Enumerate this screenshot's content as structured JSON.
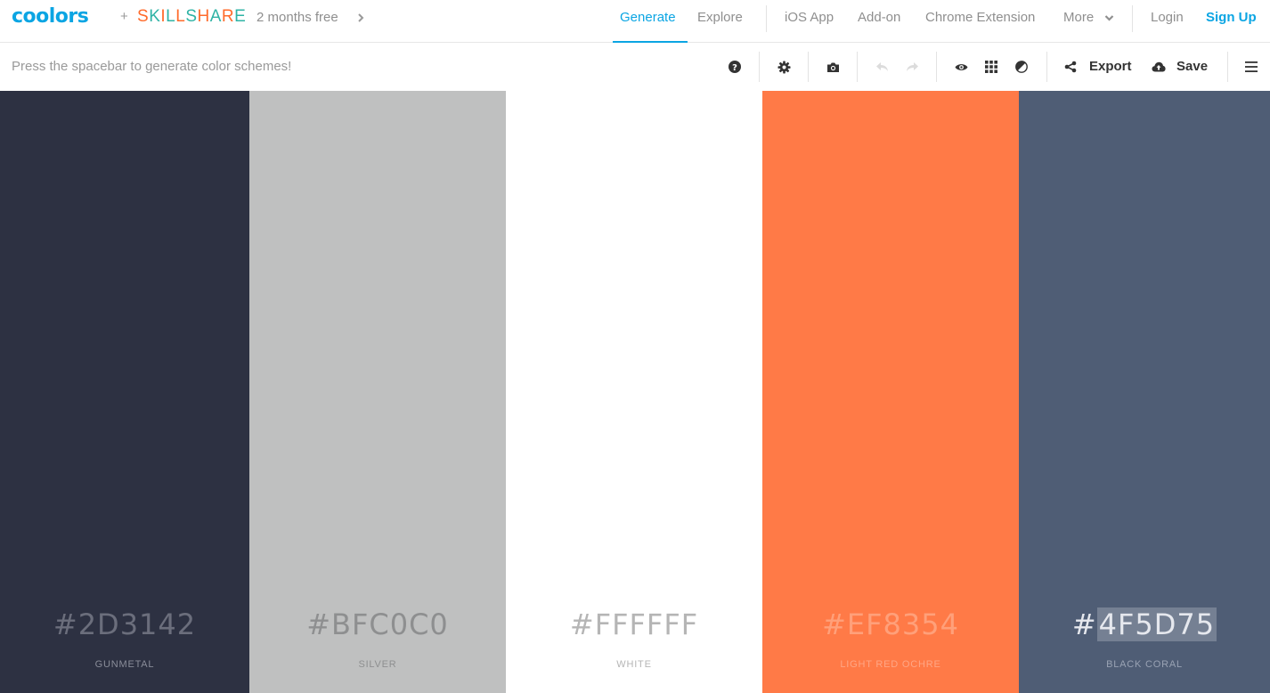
{
  "brand": {
    "logo": "coolors",
    "plus": "+",
    "partner_letters": [
      "S",
      "K",
      "I",
      "L",
      "L",
      "S",
      "H",
      "A",
      "R",
      "E"
    ],
    "partner_colors": [
      "#ff6b2b",
      "#2fb3a5",
      "#ff6b2b",
      "#2fb3a5",
      "#ff6b2b",
      "#2fb3a5",
      "#ff6b2b",
      "#2fb3a5",
      "#ff6b2b",
      "#2fb3a5"
    ],
    "promo": "2 months free"
  },
  "nav": {
    "generate": "Generate",
    "explore": "Explore",
    "ios": "iOS App",
    "addon": "Add-on",
    "chrome": "Chrome Extension",
    "more": "More",
    "login": "Login",
    "signup": "Sign Up"
  },
  "toolbar": {
    "hint": "Press the spacebar to generate color schemes!",
    "export": "Export",
    "save": "Save",
    "icons": [
      "help-icon",
      "settings-icon",
      "camera-icon",
      "undo-icon",
      "redo-icon",
      "view-icon",
      "grid-icon",
      "adjust-icon",
      "share-icon",
      "cloud-upload-icon",
      "menu-icon"
    ]
  },
  "colors": {
    "accent": "#0ba5e3"
  },
  "palette": [
    {
      "hex_prefix": "#",
      "hex": "2D3142",
      "name": "GUNMETAL",
      "color": "#2d3142",
      "text_color": "#6b6e7c",
      "label_color": "#8a8d99"
    },
    {
      "hex_prefix": "#",
      "hex": "BFC0C0",
      "name": "SILVER",
      "color": "#bfc0c0",
      "text_color": "#8e8f90",
      "label_color": "#8e8f90"
    },
    {
      "hex_prefix": "#",
      "hex": "FFFFFF",
      "name": "WHITE",
      "color": "#ffffff",
      "text_color": "#b5b5b5",
      "label_color": "#b5b5b5"
    },
    {
      "hex_prefix": "#",
      "hex": "EF8354",
      "name": "LIGHT RED OCHRE",
      "color": "#ff7a47",
      "text_color": "#ffa07a",
      "label_color": "#ffa685"
    },
    {
      "hex_prefix": "#",
      "hex": "4F5D75",
      "name": "BLACK CORAL",
      "color": "#4f5d75",
      "text_color": "#e6e8ee",
      "label_color": "#99a2b3",
      "selected": true
    }
  ]
}
